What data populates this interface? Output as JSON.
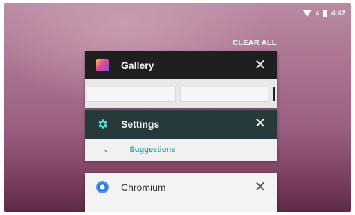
{
  "statusbar": {
    "time": "4:42",
    "signal": "4"
  },
  "recents": {
    "clear_all": "CLEAR ALL",
    "cards": [
      {
        "title": "Gallery",
        "icon": "gallery-icon"
      },
      {
        "title": "Settings",
        "icon": "gear-icon",
        "suggestions": "Suggestions"
      },
      {
        "title": "Chromium",
        "icon": "chromium-icon"
      }
    ]
  },
  "colors": {
    "accent_teal": "#1aa39a",
    "gallery_header": "#1f1f1f",
    "settings_header": "#263a3c"
  }
}
